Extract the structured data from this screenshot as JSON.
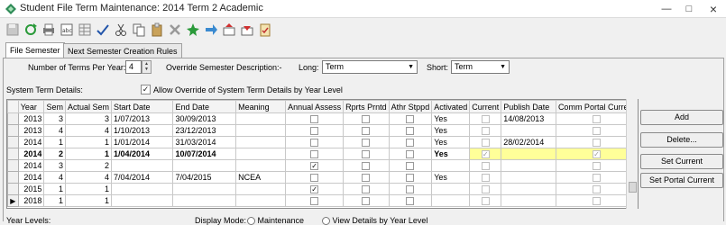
{
  "window": {
    "title": "Student File Term Maintenance: 2014 Term 2 Academic"
  },
  "toolbar": {
    "icons": [
      "save-icon",
      "refresh-icon",
      "print-icon",
      "calculator-icon",
      "grid-icon",
      "spellcheck-icon",
      "cut-icon",
      "copy-icon",
      "paste-icon",
      "delete-icon",
      "pin-icon",
      "forward-icon",
      "export-icon",
      "import-icon",
      "task-icon"
    ]
  },
  "tabs": [
    {
      "label": "File Semester",
      "active": true
    },
    {
      "label": "Next Semester Creation Rules",
      "active": false
    }
  ],
  "form": {
    "num_terms_label": "Number of Terms Per Year:",
    "num_terms_value": "4",
    "override_desc_label": "Override Semester Description:-",
    "long_label": "Long:",
    "long_value": "Term",
    "short_label": "Short:",
    "short_value": "Term",
    "system_details_label": "System Term Details:",
    "allow_override_label": "Allow Override of System Term Details by Year Level",
    "allow_override_checked": true
  },
  "grid": {
    "columns": [
      "Year",
      "Sem",
      "Actual Sem",
      "Start Date",
      "End Date",
      "Meaning",
      "Annual Assess",
      "Rprts Prntd",
      "Athr Stppd",
      "Activated",
      "Current",
      "Publish Date",
      "Comm Portal Current"
    ],
    "rows": [
      {
        "year": "2013",
        "sem": "3",
        "actual": "3",
        "start": "1/07/2013",
        "end": "30/09/2013",
        "meaning": "",
        "annual": false,
        "rprts": false,
        "athr": false,
        "activated": "Yes",
        "current": false,
        "publish": "14/08/2013",
        "portal": false,
        "selected": false,
        "current_row": false
      },
      {
        "year": "2013",
        "sem": "4",
        "actual": "4",
        "start": "1/10/2013",
        "end": "23/12/2013",
        "meaning": "",
        "annual": false,
        "rprts": false,
        "athr": false,
        "activated": "Yes",
        "current": false,
        "publish": "",
        "portal": false,
        "selected": false,
        "current_row": false
      },
      {
        "year": "2014",
        "sem": "1",
        "actual": "1",
        "start": "1/01/2014",
        "end": "31/03/2014",
        "meaning": "",
        "annual": false,
        "rprts": false,
        "athr": false,
        "activated": "Yes",
        "current": false,
        "publish": "28/02/2014",
        "portal": false,
        "selected": false,
        "current_row": false
      },
      {
        "year": "2014",
        "sem": "2",
        "actual": "1",
        "start": "1/04/2014",
        "end": "10/07/2014",
        "meaning": "",
        "annual": false,
        "rprts": false,
        "athr": false,
        "activated": "Yes",
        "current": true,
        "publish": "",
        "portal": true,
        "selected": true,
        "current_row": false
      },
      {
        "year": "2014",
        "sem": "3",
        "actual": "2",
        "start": "",
        "end": "",
        "meaning": "",
        "annual": true,
        "rprts": false,
        "athr": false,
        "activated": "",
        "current": false,
        "publish": "",
        "portal": false,
        "selected": false,
        "current_row": false
      },
      {
        "year": "2014",
        "sem": "4",
        "actual": "4",
        "start": "7/04/2014",
        "end": "7/04/2015",
        "meaning": "NCEA",
        "annual": false,
        "rprts": false,
        "athr": false,
        "activated": "Yes",
        "current": false,
        "publish": "",
        "portal": false,
        "selected": false,
        "current_row": false
      },
      {
        "year": "2015",
        "sem": "1",
        "actual": "1",
        "start": "",
        "end": "",
        "meaning": "",
        "annual": true,
        "rprts": false,
        "athr": false,
        "activated": "",
        "current": false,
        "publish": "",
        "portal": false,
        "selected": false,
        "current_row": false
      },
      {
        "year": "2018",
        "sem": "1",
        "actual": "1",
        "start": "",
        "end": "",
        "meaning": "",
        "annual": false,
        "rprts": false,
        "athr": false,
        "activated": "",
        "current": false,
        "publish": "",
        "portal": false,
        "selected": false,
        "current_row": true
      }
    ]
  },
  "buttons": {
    "add": "Add",
    "delete": "Delete...",
    "set_current": "Set Current",
    "set_portal_current": "Set Portal Current"
  },
  "bottom": {
    "year_levels_label": "Year Levels:",
    "display_mode_label": "Display Mode:",
    "maintenance_label": "Maintenance",
    "view_details_label": "View Details by Year Level"
  },
  "colors": {
    "highlight": "#ffff99"
  }
}
